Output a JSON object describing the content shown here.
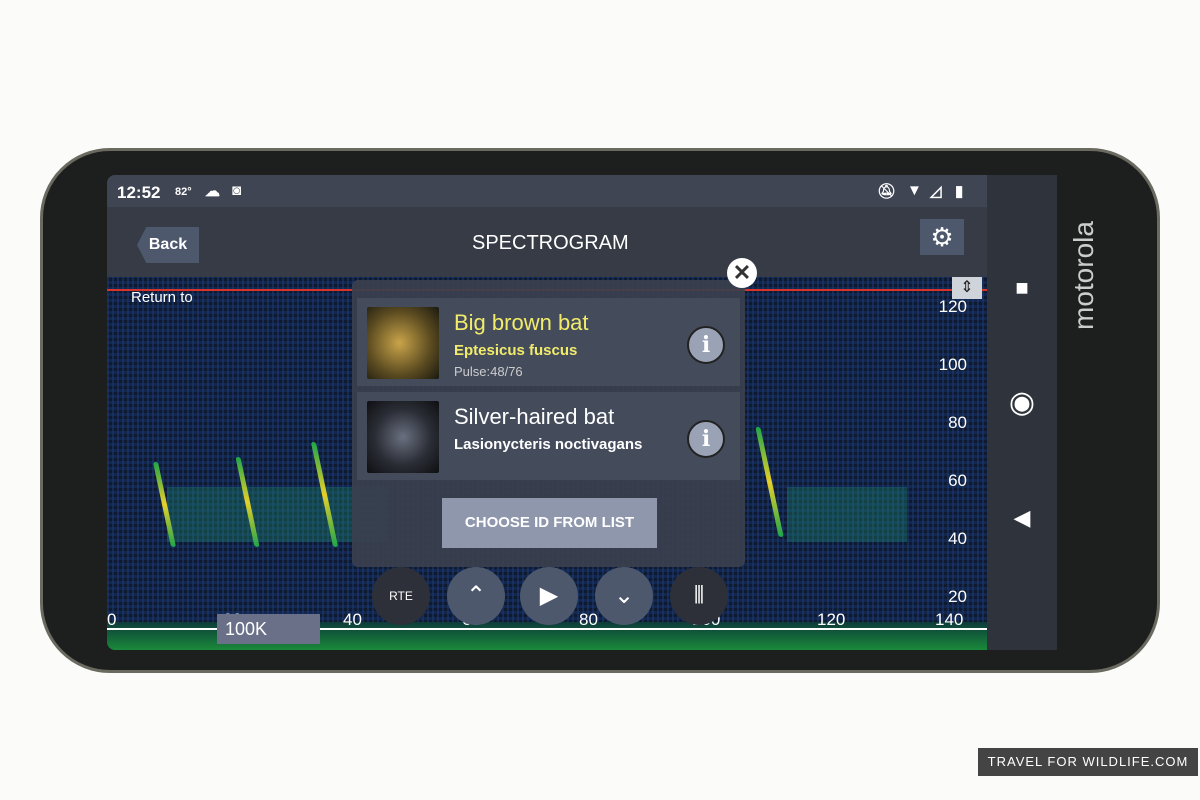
{
  "status": {
    "time": "12:52",
    "temp": "82°"
  },
  "header": {
    "back": "Back",
    "title": "SPECTROGRAM"
  },
  "spectrogram": {
    "return_label": "Return to",
    "y_ticks": [
      "120",
      "100",
      "80",
      "60",
      "40",
      "20"
    ],
    "x_ticks": [
      "0",
      "20",
      "40",
      "60",
      "80",
      "100",
      "120",
      "140"
    ],
    "rate_label": "100K"
  },
  "popup": {
    "results": [
      {
        "name": "Big brown bat",
        "scientific": "Eptesicus fuscus",
        "pulse": "Pulse:48/76",
        "name_color": "#f2ec6a"
      },
      {
        "name": "Silver-haired bat",
        "scientific": "Lasionycteris noctivagans",
        "name_color": "#ffffff"
      }
    ],
    "choose": "CHOOSE ID FROM LIST"
  },
  "controls": {
    "rte": "RTE"
  },
  "device": {
    "brand": "motorola"
  },
  "watermark": "TRAVEL FOR WILDLIFE.COM"
}
